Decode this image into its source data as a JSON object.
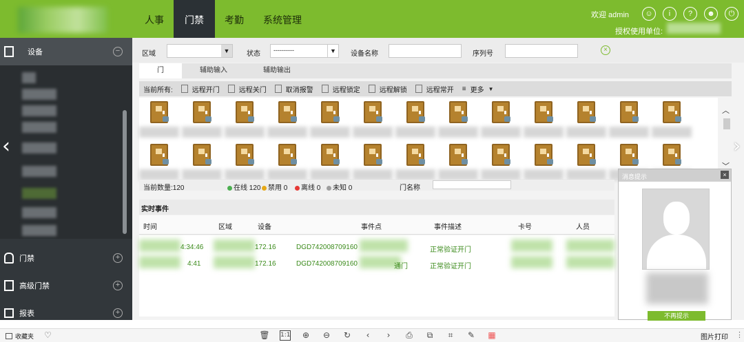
{
  "header": {
    "tabs": [
      {
        "label": "人事"
      },
      {
        "label": "门禁",
        "active": true
      },
      {
        "label": "考勤"
      },
      {
        "label": "系统管理"
      }
    ],
    "welcome": "欢迎 admin",
    "authorized_unit": "授权使用单位:",
    "icons": [
      "user-circle-icon",
      "info-icon",
      "help-icon",
      "account-icon",
      "power-icon"
    ],
    "accent_color": "#7dbb2e"
  },
  "sidebar": {
    "section_title": "设备",
    "items": [
      {
        "label": "门禁",
        "icon": "lock-icon"
      },
      {
        "label": "高级门禁",
        "icon": "advanced-door-icon"
      },
      {
        "label": "报表",
        "icon": "report-icon"
      }
    ]
  },
  "filters": {
    "area_label": "区域",
    "status_label": "状态",
    "status_value": "----------",
    "device_name_label": "设备名称",
    "serial_label": "序列号"
  },
  "subtabs": [
    "门",
    "辅助输入",
    "辅助输出"
  ],
  "toolbar": {
    "current_all": "当前所有:",
    "actions": [
      "远程开门",
      "远程关门",
      "取消报警",
      "远程锁定",
      "远程解锁",
      "远程常开",
      "更多"
    ]
  },
  "status": {
    "count": "当前数量:120",
    "online": "在线 120",
    "disabled": "禁用 0",
    "offline": "离线 0",
    "unknown": "未知 0",
    "door_name_label": "门名称"
  },
  "events": {
    "title": "实时事件",
    "columns": [
      "时间",
      "区域",
      "设备",
      "事件点",
      "事件描述",
      "卡号",
      "人员"
    ],
    "rows": [
      {
        "time": "4:34:46",
        "device": "172.16",
        "device_sn": "DGD742008709160",
        "point": "",
        "desc": "正常验证开门"
      },
      {
        "time": "4:41",
        "device": "172.16",
        "device_sn": "DGD742008709160",
        "point": "通门",
        "desc": "正常验证开门"
      }
    ]
  },
  "popup": {
    "title": "消息提示",
    "close": "×",
    "button": "不再提示"
  },
  "bottom": {
    "favorites": "收藏夹",
    "print": "图片打印"
  }
}
